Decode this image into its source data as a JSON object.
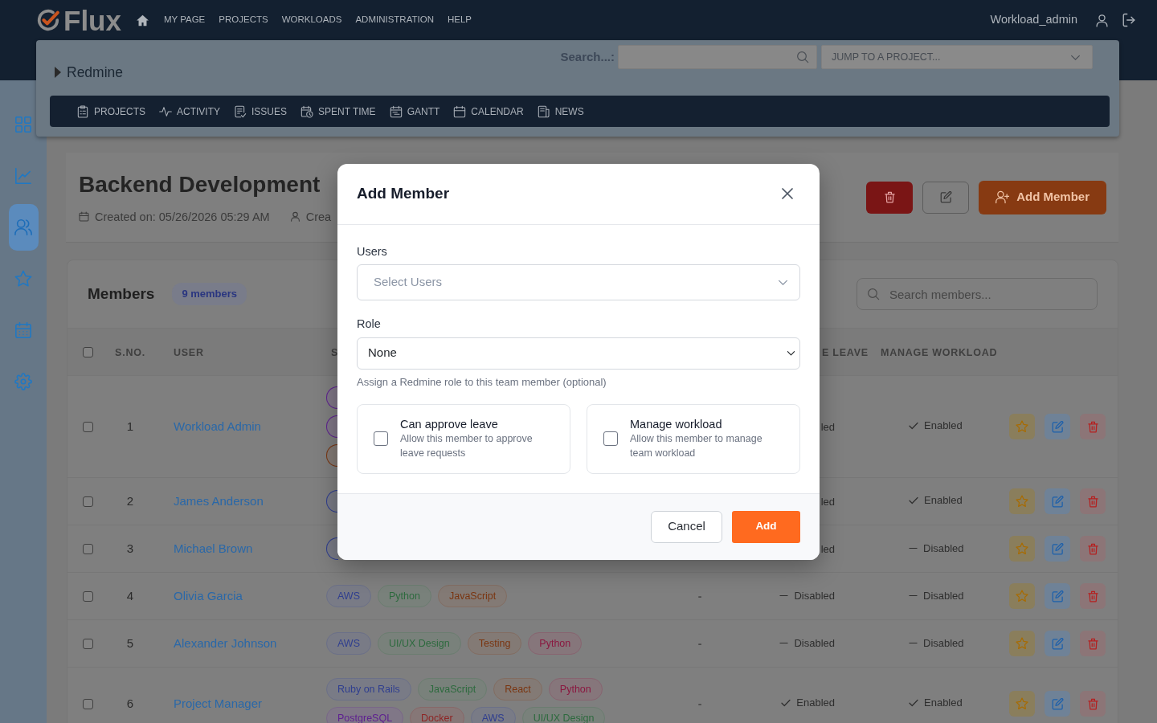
{
  "header": {
    "brand": "Flux",
    "nav": [
      "MY PAGE",
      "PROJECTS",
      "WORKLOADS",
      "ADMINISTRATION",
      "HELP"
    ],
    "user": "Workload_admin"
  },
  "project_panel": {
    "title": "Redmine",
    "search": {
      "label": "Search...:"
    },
    "jump": {
      "placeholder": "JUMP TO A PROJECT..."
    },
    "menu": [
      "PROJECTS",
      "ACTIVITY",
      "ISSUES",
      "SPENT TIME",
      "GANTT",
      "CALENDAR",
      "NEWS"
    ]
  },
  "sidebar": {
    "items": [
      {
        "selected": false
      },
      {
        "selected": false
      },
      {
        "selected": true
      },
      {
        "selected": false
      },
      {
        "selected": false
      },
      {
        "selected": false
      }
    ]
  },
  "project": {
    "title": "Backend Development",
    "meta": [
      "Created on: 05/26/2026 05:29 AM",
      "Crea"
    ],
    "add_button": "Add Member"
  },
  "members": {
    "title": "Members",
    "count": "9 members",
    "search": {
      "placeholder": "Search members..."
    }
  },
  "table": {
    "header": {
      "select_all": {
        "checked": false
      },
      "sno": "S.NO.",
      "user": "USER",
      "column_4": "S",
      "column_6": "E LEAVE",
      "manage_workload": "MANAGE WORKLOAD"
    },
    "rows": [
      {
        "checked": false,
        "sno": "1",
        "user": "Workload Admin",
        "column_4": [
          {
            "color": "#5e2090"
          },
          {
            "color": "#5e2090"
          },
          {
            "color": "#7a3510"
          }
        ],
        "column_6": {
          "label": "led"
        },
        "manage_workload": {
          "enabled": true,
          "label": "Enabled"
        }
      },
      {
        "checked": false,
        "sno": "2",
        "user": "James Anderson",
        "column_4": [
          {
            "color": "#2f3e8f"
          }
        ],
        "column_6": {
          "label": "led"
        },
        "manage_workload": {
          "enabled": true,
          "label": "Enabled"
        }
      },
      {
        "checked": false,
        "sno": "3",
        "user": "Michael Brown",
        "column_4": [
          {
            "color": "#2f3e8f"
          }
        ],
        "column_6": {
          "label": "led"
        },
        "manage_workload": {
          "enabled": false,
          "label": "Disabled"
        }
      },
      {
        "checked": false,
        "sno": "4",
        "user": "Olivia Garcia",
        "column_4": [
          {
            "label": "AWS",
            "color": "#2f3e8f"
          },
          {
            "label": "Python",
            "color": "#2d6a3e"
          },
          {
            "label": "JavaScript",
            "color": "#7a3510"
          }
        ],
        "column_5": "-",
        "column_6": {
          "enabled": false,
          "label": "Disabled"
        },
        "manage_workload": {
          "enabled": false,
          "label": "Disabled"
        }
      },
      {
        "checked": false,
        "sno": "5",
        "user": "Alexander Johnson",
        "column_4": [
          {
            "label": "AWS",
            "color": "#2f3e8f"
          },
          {
            "label": "UI/UX Design",
            "color": "#2d6a3e"
          },
          {
            "label": "Testing",
            "color": "#7a3510"
          },
          {
            "label": "Python",
            "color": "#8a1840"
          }
        ],
        "column_5": "-",
        "column_6": {
          "enabled": false,
          "label": "Disabled"
        },
        "manage_workload": {
          "enabled": false,
          "label": "Disabled"
        }
      },
      {
        "checked": false,
        "sno": "6",
        "user": "Project Manager",
        "column_4": [
          {
            "label": "Ruby on Rails",
            "color": "#2f3e8f"
          },
          {
            "label": "JavaScript",
            "color": "#2d6a3e"
          },
          {
            "label": "React",
            "color": "#7a3510"
          },
          {
            "label": "Python",
            "color": "#8a1840"
          },
          {
            "label": "PostgreSQL",
            "color": "#5e2090"
          },
          {
            "label": "Docker",
            "color": "#8e2424"
          },
          {
            "label": "AWS",
            "color": "#2f3e8f"
          },
          {
            "label": "UI/UX Design",
            "color": "#2d6a3e"
          }
        ],
        "column_5": "-",
        "column_6": {
          "enabled": true,
          "label": "Enabled"
        },
        "manage_workload": {
          "enabled": true,
          "label": "Enabled"
        }
      }
    ]
  },
  "modal": {
    "title": "Add Member",
    "users": {
      "label": "Users",
      "placeholder": "Select Users"
    },
    "role": {
      "label": "Role",
      "value": "None",
      "help": "Assign a Redmine role to this team member (optional)"
    },
    "options": [
      {
        "title": "Can approve leave",
        "description": "Allow this member to approve leave requests",
        "checked": false
      },
      {
        "title": "Manage workload",
        "description": "Allow this member to manage team workload",
        "checked": false
      }
    ],
    "buttons": {
      "cancel": "Cancel",
      "add": "Add"
    }
  }
}
